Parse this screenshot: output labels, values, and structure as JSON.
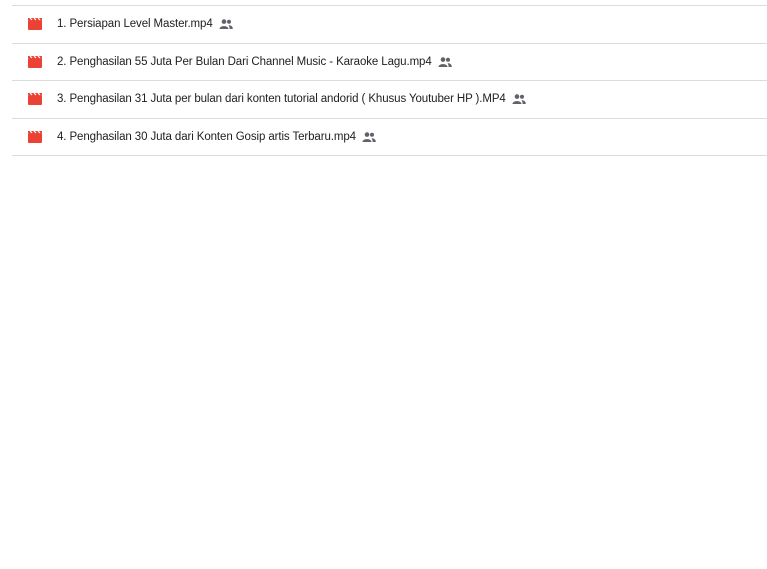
{
  "files": [
    {
      "name": "1. Persiapan Level Master.mp4",
      "type_icon": "video-file-icon",
      "shared_icon": "shared-people-icon"
    },
    {
      "name": "2. Penghasilan 55 Juta Per Bulan Dari Channel Music - Karaoke Lagu.mp4",
      "type_icon": "video-file-icon",
      "shared_icon": "shared-people-icon"
    },
    {
      "name": "3. Penghasilan 31 Juta per bulan dari konten tutorial andorid ( Khusus Youtuber HP ).MP4",
      "type_icon": "video-file-icon",
      "shared_icon": "shared-people-icon"
    },
    {
      "name": "4. Penghasilan 30 Juta dari Konten Gosip artis Terbaru.mp4",
      "type_icon": "video-file-icon",
      "shared_icon": "shared-people-icon"
    }
  ],
  "colors": {
    "video_icon": "#ea4335",
    "shared_icon": "#5f6368",
    "divider": "#dadce0",
    "text": "#202124"
  }
}
